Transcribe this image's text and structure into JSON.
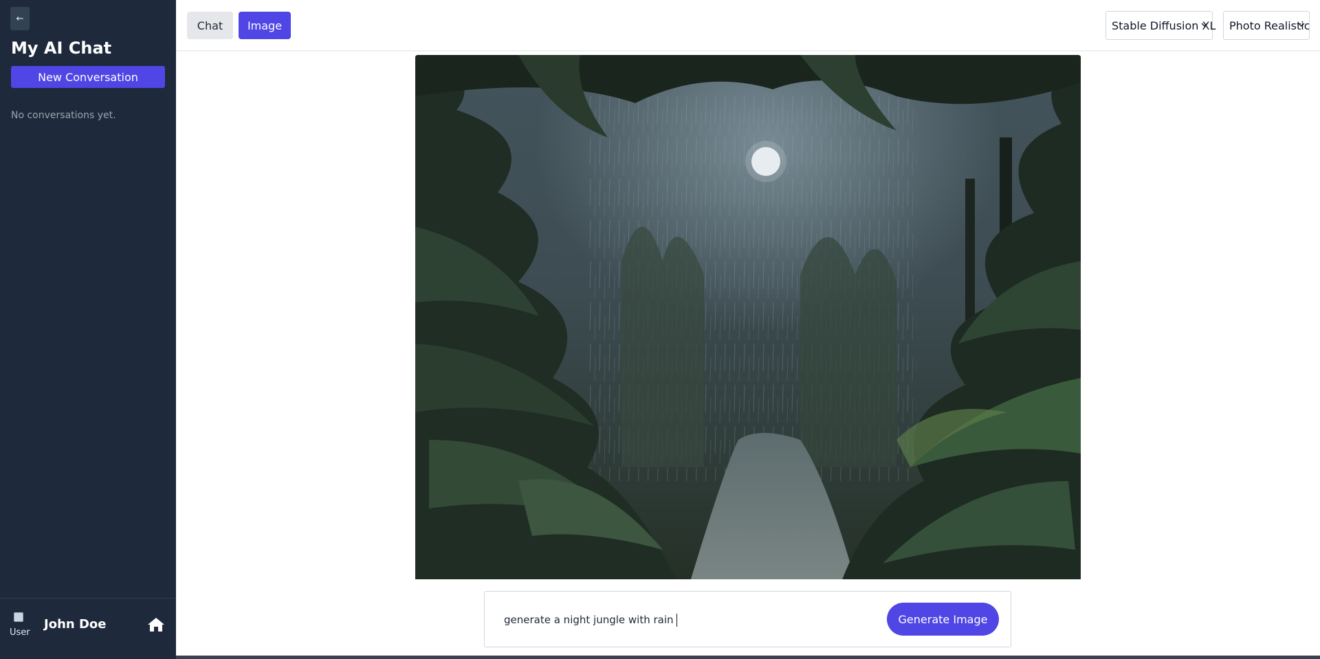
{
  "sidebar": {
    "collapse_glyph": "←",
    "app_title": "My AI Chat",
    "new_conversation_label": "New Conversation",
    "empty_message": "No conversations yet.",
    "user": {
      "avatar_alt": "User",
      "name": "John Doe",
      "home_icon": "home-icon"
    }
  },
  "header": {
    "tabs": [
      {
        "label": "Chat",
        "active": false
      },
      {
        "label": "Image",
        "active": true
      }
    ],
    "model_select": {
      "value": "Stable Diffusion XL"
    },
    "style_select": {
      "value": "Photo Realistic"
    }
  },
  "main": {
    "image_alt": "Generated image"
  },
  "prompt": {
    "value": "generate a night jungle with rain",
    "generate_label": "Generate Image"
  },
  "colors": {
    "sidebar_bg": "#1e293b",
    "accent": "#4f46e5"
  }
}
